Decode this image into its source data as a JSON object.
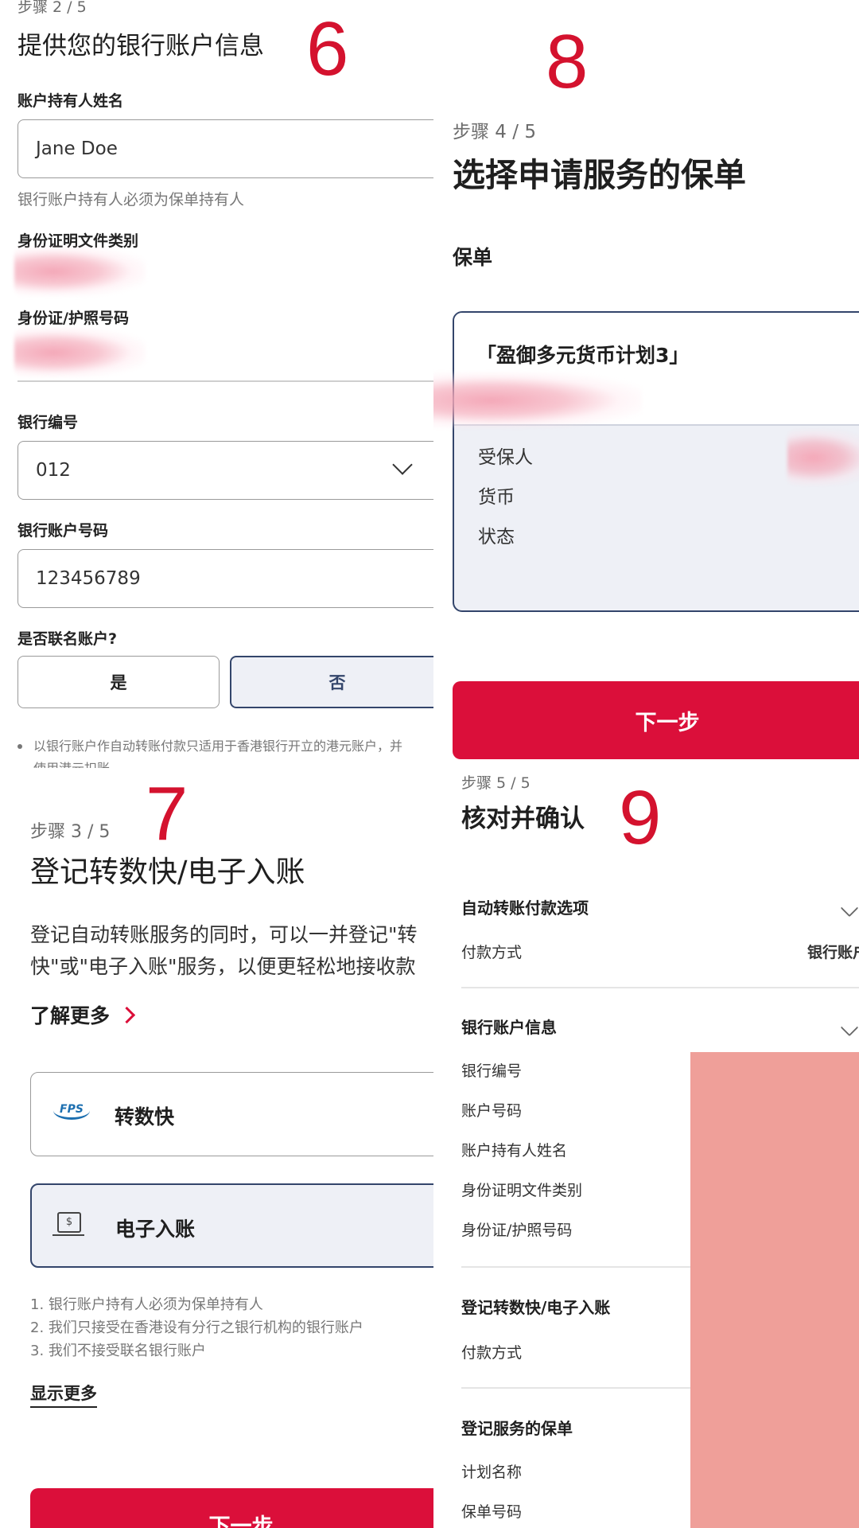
{
  "labels": {
    "marker6": "6",
    "marker7": "7",
    "marker8": "8",
    "marker9": "9"
  },
  "panel6": {
    "step": "步骤 2 / 5",
    "title": "提供您的银行账户信息",
    "holder_label": "账户持有人姓名",
    "holder_value": "Jane Doe",
    "holder_hint": "银行账户持有人必须为保单持有人",
    "id_type_label": "身份证明文件类别",
    "id_number_label": "身份证/护照号码",
    "bank_code_label": "银行编号",
    "bank_code_value": "012",
    "account_label": "银行账户号码",
    "account_value": "123456789",
    "joint_label": "是否联名账户?",
    "yes": "是",
    "no": "否",
    "note": "以银行账户作自动转账付款只适用于香港银行开立的港元账户，并",
    "note_cut": "使用港元扣账"
  },
  "panel7": {
    "step": "步骤 3 / 5",
    "title": "登记转数快/电子入账",
    "desc_line1": "登记自动转账服务的同时，可以一并登记\"转",
    "desc_line2": "快\"或\"电子入账\"服务，以便更轻松地接收款",
    "learn_more": "了解更多",
    "fps_logo": "FPS",
    "fps_label": "转数快",
    "edda_label": "电子入账",
    "notes": [
      "1.  银行账户持有人必须为保单持有人",
      "2.  我们只接受在香港设有分行之银行机构的银行账户",
      "3.  我们不接受联名银行账户"
    ],
    "show_more": "显示更多",
    "next": "下一步"
  },
  "panel8": {
    "step": "步骤 4 / 5",
    "title": "选择申请服务的保单",
    "section": "保单",
    "plan_name": "「盈御多元货币计划3」",
    "rows": [
      "受保人",
      "货币",
      "状态"
    ],
    "next": "下一步"
  },
  "panel9": {
    "step": "步骤 5 / 5",
    "title": "核对并确认",
    "sec1_title": "自动转账付款选项",
    "sec1_rows": [
      "付款方式"
    ],
    "sec1_value": "银行账户",
    "sec2_title": "银行账户信息",
    "sec2_rows": [
      "银行编号",
      "账户号码",
      "账户持有人姓名",
      "身份证明文件类别",
      "身份证/护照号码"
    ],
    "sec3_title": "登记转数快/电子入账",
    "sec3_rows": [
      "付款方式"
    ],
    "sec4_title": "登记服务的保单",
    "sec4_rows": [
      "计划名称",
      "保单号码"
    ]
  },
  "colors": {
    "accent": "#db0f3a",
    "marker": "#d4122e",
    "redaction": "#ef9f99",
    "border_navy": "#33456b"
  }
}
